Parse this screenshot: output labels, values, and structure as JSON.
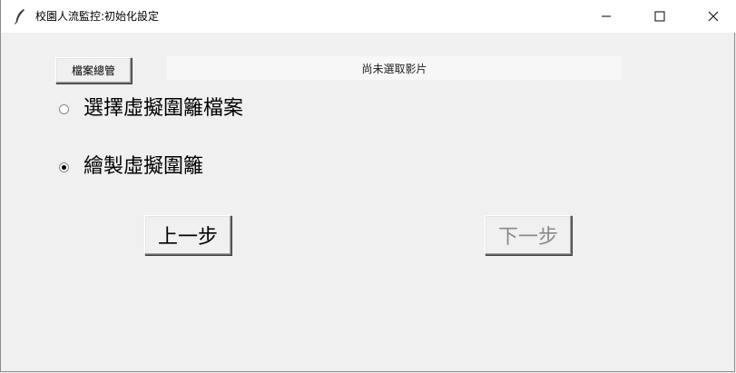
{
  "window": {
    "title": "校園人流監控:初始化設定"
  },
  "toolbar": {
    "file_button_label": "檔案總管",
    "status_text": "尚未選取影片"
  },
  "options": {
    "items": [
      {
        "label": "選擇虛擬圍籬檔案",
        "selected": false
      },
      {
        "label": "繪製虛擬圍籬",
        "selected": true
      }
    ]
  },
  "navigation": {
    "prev_label": "上一步",
    "next_label": "下一步",
    "next_disabled": true
  }
}
